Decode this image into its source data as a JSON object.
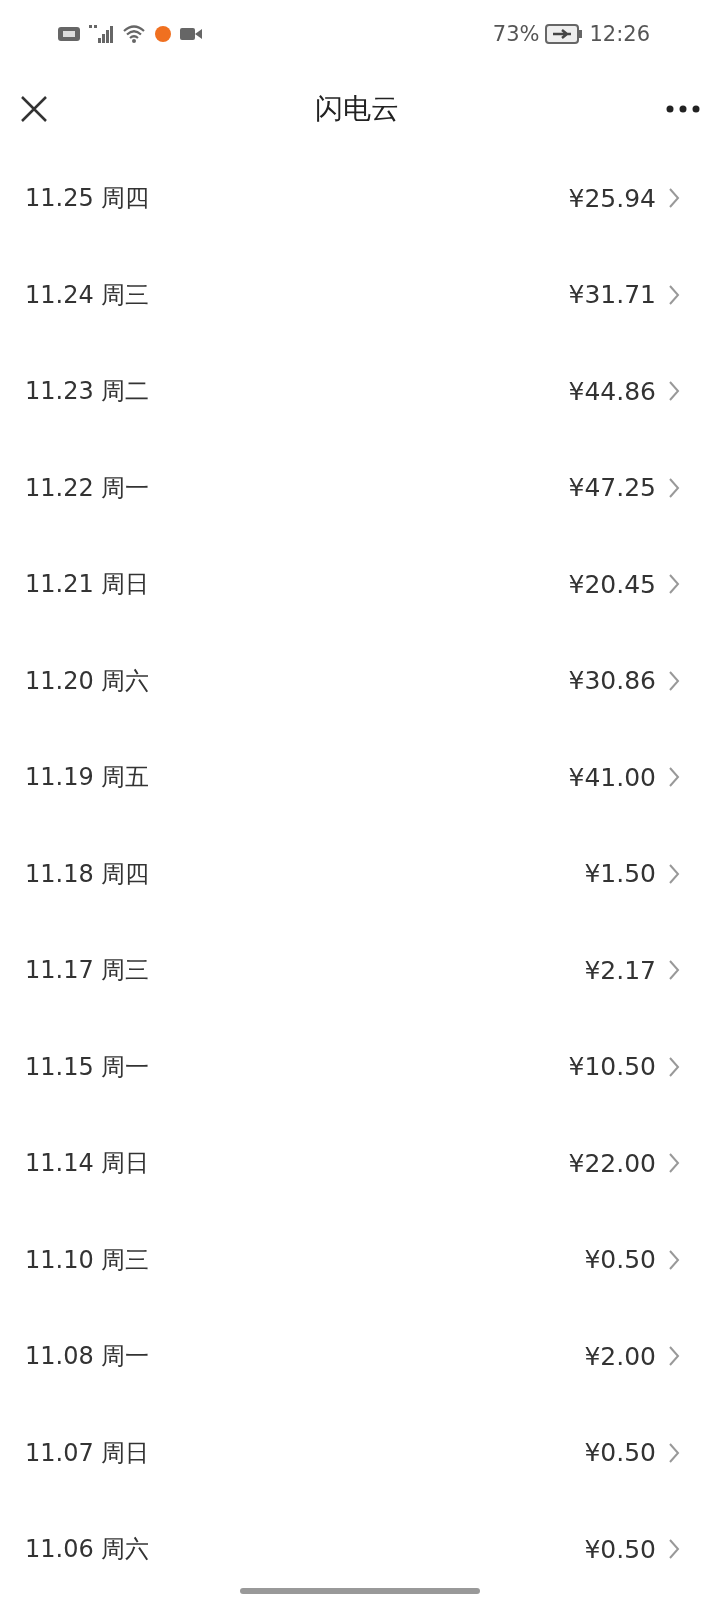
{
  "status_bar": {
    "battery_percent": "73%",
    "time": "12:26"
  },
  "header": {
    "title": "闪电云"
  },
  "rows": [
    {
      "date": "11.25 周四",
      "amount": "¥25.94"
    },
    {
      "date": "11.24 周三",
      "amount": "¥31.71"
    },
    {
      "date": "11.23 周二",
      "amount": "¥44.86"
    },
    {
      "date": "11.22 周一",
      "amount": "¥47.25"
    },
    {
      "date": "11.21 周日",
      "amount": "¥20.45"
    },
    {
      "date": "11.20 周六",
      "amount": "¥30.86"
    },
    {
      "date": "11.19 周五",
      "amount": "¥41.00"
    },
    {
      "date": "11.18 周四",
      "amount": "¥1.50"
    },
    {
      "date": "11.17 周三",
      "amount": "¥2.17"
    },
    {
      "date": "11.15 周一",
      "amount": "¥10.50"
    },
    {
      "date": "11.14 周日",
      "amount": "¥22.00"
    },
    {
      "date": "11.10 周三",
      "amount": "¥0.50"
    },
    {
      "date": "11.08 周一",
      "amount": "¥2.00"
    },
    {
      "date": "11.07 周日",
      "amount": "¥0.50"
    },
    {
      "date": "11.06 周六",
      "amount": "¥0.50"
    }
  ]
}
